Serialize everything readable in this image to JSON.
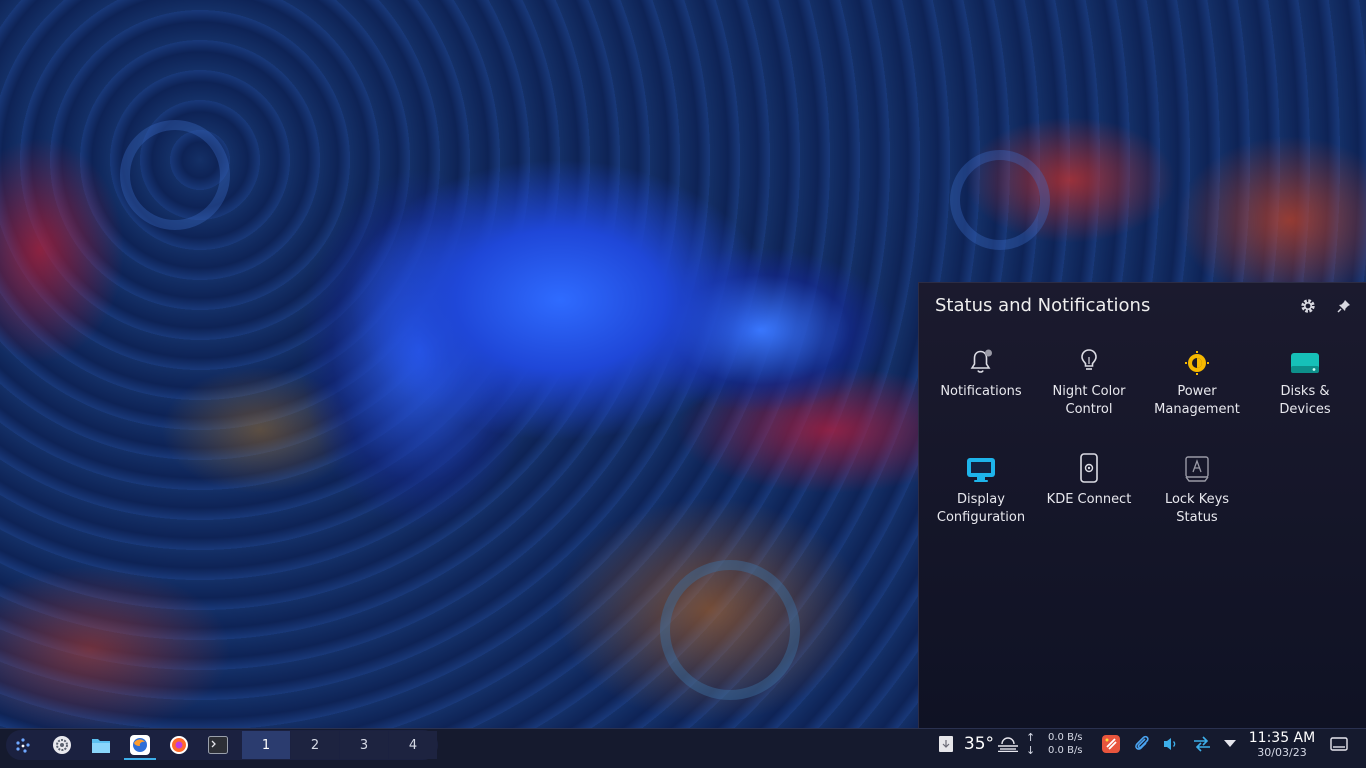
{
  "popup": {
    "title": "Status and Notifications",
    "settings_icon": "gear-icon",
    "pin_icon": "pin-icon",
    "tiles": [
      {
        "label": "Notifications",
        "icon": "bell-icon"
      },
      {
        "label": "Night Color Control",
        "icon": "lightbulb-icon"
      },
      {
        "label": "Power Management",
        "icon": "battery-icon"
      },
      {
        "label": "Disks & Devices",
        "icon": "drive-icon"
      },
      {
        "label": "Display Configuration",
        "icon": "monitor-icon"
      },
      {
        "label": "KDE Connect",
        "icon": "phone-icon"
      },
      {
        "label": "Lock Keys Status",
        "icon": "keyboard-key-icon"
      }
    ]
  },
  "taskbar": {
    "launchers": [
      {
        "name": "application-launcher",
        "icon": "app-menu-icon"
      },
      {
        "name": "system-settings",
        "icon": "settings-icon"
      },
      {
        "name": "file-manager",
        "icon": "folder-icon"
      },
      {
        "name": "firefox",
        "icon": "firefox-icon"
      },
      {
        "name": "firefox-alt",
        "icon": "firefox-icon"
      },
      {
        "name": "terminal",
        "icon": "terminal-icon"
      }
    ],
    "desktops": [
      "1",
      "2",
      "3",
      "4"
    ],
    "active_desktop": "1",
    "weather": {
      "temperature": "35°"
    },
    "network": {
      "upload": "0.0 B/s",
      "download": "0.0 B/s",
      "up_arrow": "↑",
      "down_arrow": "↓"
    },
    "clock": {
      "time": "11:35 AM",
      "date": "30/03/23"
    }
  },
  "colors": {
    "accent": "#3daee9",
    "power": "#f5b800",
    "disk": "#16c0b8",
    "display": "#1eb4ea"
  }
}
